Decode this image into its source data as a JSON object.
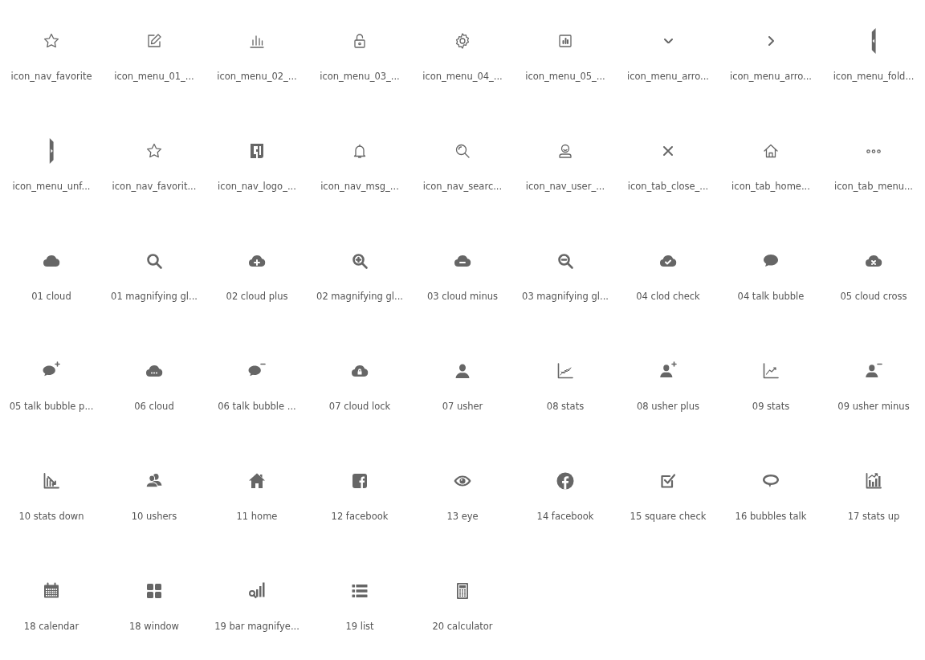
{
  "icons": [
    {
      "label": "icon_nav_favorite",
      "kind": "star"
    },
    {
      "label": "icon_menu_01_...",
      "kind": "pencil"
    },
    {
      "label": "icon_menu_02_...",
      "kind": "bars"
    },
    {
      "label": "icon_menu_03_...",
      "kind": "lock"
    },
    {
      "label": "icon_menu_04_...",
      "kind": "gear"
    },
    {
      "label": "icon_menu_05_...",
      "kind": "chartsquare"
    },
    {
      "label": "icon_menu_arro...",
      "kind": "chevrondown"
    },
    {
      "label": "icon_menu_arro...",
      "kind": "chevronright"
    },
    {
      "label": "icon_menu_fold...",
      "kind": "fold"
    },
    {
      "label": "icon_menu_unf...",
      "kind": "unfold"
    },
    {
      "label": "icon_nav_favorit...",
      "kind": "star"
    },
    {
      "label": "icon_nav_logo_...",
      "kind": "logo"
    },
    {
      "label": "icon_nav_msg_...",
      "kind": "bell"
    },
    {
      "label": "icon_nav_searc...",
      "kind": "search"
    },
    {
      "label": "icon_nav_user_...",
      "kind": "useroutline"
    },
    {
      "label": "icon_tab_close_...",
      "kind": "close"
    },
    {
      "label": "icon_tab_home...",
      "kind": "homeoutline"
    },
    {
      "label": "icon_tab_menu...",
      "kind": "dots"
    },
    {
      "label": "01 cloud",
      "kind": "cloud"
    },
    {
      "label": "01 magnifying gl...",
      "kind": "magnifier"
    },
    {
      "label": "02 cloud plus",
      "kind": "cloudplus"
    },
    {
      "label": "02 magnifying gl...",
      "kind": "magnifierplus"
    },
    {
      "label": "03 cloud minus",
      "kind": "cloudminus"
    },
    {
      "label": "03 magnifying gl...",
      "kind": "magnifierminus"
    },
    {
      "label": "04 clod check",
      "kind": "cloudcheck"
    },
    {
      "label": "04 talk bubble",
      "kind": "bubble"
    },
    {
      "label": "05 cloud cross",
      "kind": "cloudcross"
    },
    {
      "label": "05 talk bubble p...",
      "kind": "bubbleplus"
    },
    {
      "label": "06 cloud",
      "kind": "clouddots"
    },
    {
      "label": "06 talk bubble ...",
      "kind": "bubbleminus"
    },
    {
      "label": "07 cloud lock",
      "kind": "cloudlock"
    },
    {
      "label": "07 usher",
      "kind": "person"
    },
    {
      "label": "08 stats",
      "kind": "statsscatter"
    },
    {
      "label": "08 usher plus",
      "kind": "personplus"
    },
    {
      "label": "09 stats",
      "kind": "statsline"
    },
    {
      "label": "09 usher minus",
      "kind": "personminus"
    },
    {
      "label": "10 stats down",
      "kind": "statsdown"
    },
    {
      "label": "10 ushers",
      "kind": "people"
    },
    {
      "label": "11 home",
      "kind": "house"
    },
    {
      "label": "12 facebook",
      "kind": "fbsquare"
    },
    {
      "label": "13 eye",
      "kind": "eye"
    },
    {
      "label": "14 facebook",
      "kind": "fbcircle"
    },
    {
      "label": "15 square check",
      "kind": "squarecheck"
    },
    {
      "label": "16 bubbles talk",
      "kind": "bubbles"
    },
    {
      "label": "17 stats up",
      "kind": "statsup"
    },
    {
      "label": "18 calendar",
      "kind": "calendar"
    },
    {
      "label": "18 window",
      "kind": "window"
    },
    {
      "label": "19 bar magnifye...",
      "kind": "barmagnifier"
    },
    {
      "label": "19 list",
      "kind": "list"
    },
    {
      "label": "20 calculator",
      "kind": "calculator"
    }
  ]
}
